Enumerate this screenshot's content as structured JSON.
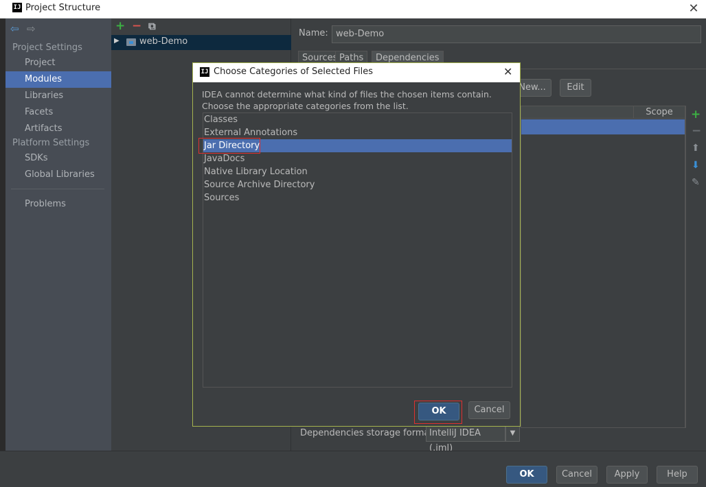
{
  "window": {
    "title": "Project Structure",
    "logo": "IJ",
    "close": "✕"
  },
  "sidebar": {
    "nav": {
      "back": "⇦",
      "forward": "⇨"
    },
    "project_settings_header": "Project Settings",
    "project_items": [
      "Project",
      "Modules",
      "Libraries",
      "Facets",
      "Artifacts"
    ],
    "platform_settings_header": "Platform Settings",
    "platform_items": [
      "SDKs",
      "Global Libraries"
    ],
    "problems": "Problems",
    "selected": "Modules"
  },
  "tree": {
    "add": "+",
    "remove": "−",
    "copy": "⧉",
    "module": "web-Demo"
  },
  "module": {
    "name_label": "Name:",
    "name_value": "web-Demo",
    "tabs": [
      "Sources",
      "Paths",
      "Dependencies"
    ],
    "new_button": "New...",
    "edit_button": "Edit",
    "scope_header": "Scope",
    "storage_label": "Dependencies storage format:",
    "storage_value": "IntelliJ IDEA (.iml)"
  },
  "dialog": {
    "title": "Choose Categories of Selected Files",
    "close": "✕",
    "message_line1": "IDEA cannot determine what kind of files the chosen items contain.",
    "message_line2": "Choose the appropriate categories from the list.",
    "items": [
      "Classes",
      "External Annotations",
      "Jar Directory",
      "JavaDocs",
      "Native Library Location",
      "Source Archive Directory",
      "Sources"
    ],
    "selected": "Jar Directory",
    "ok": "OK",
    "cancel": "Cancel"
  },
  "footer": {
    "ok": "OK",
    "cancel": "Cancel",
    "apply": "Apply",
    "help": "Help"
  },
  "colors": {
    "selection": "#4b6eaf",
    "highlight": "#e03030",
    "dialog_border": "#a6b44e",
    "add": "#3cb043",
    "remove": "#d9534f"
  }
}
